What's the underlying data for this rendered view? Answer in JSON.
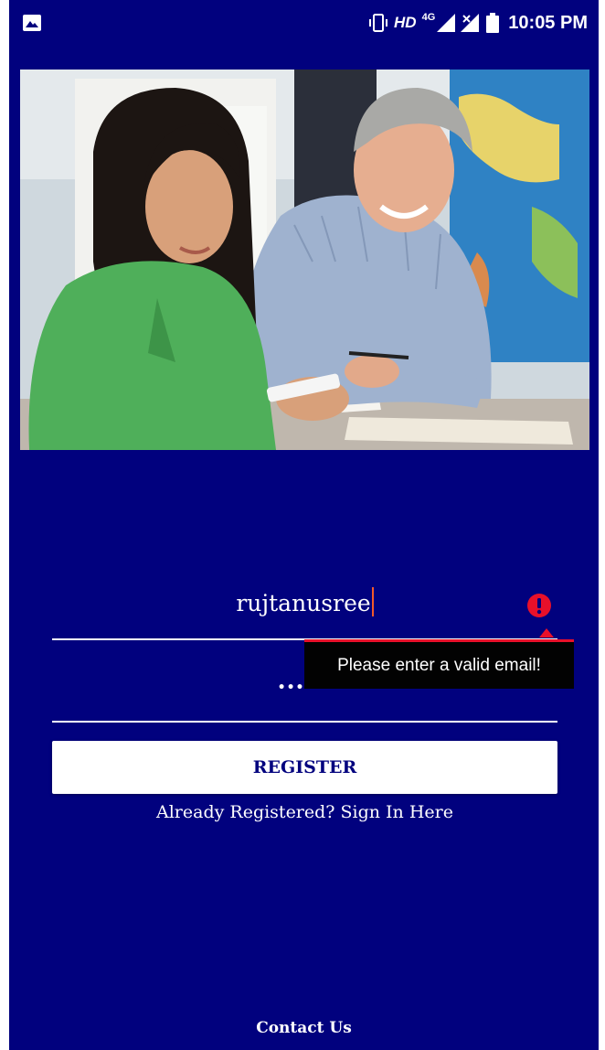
{
  "status_bar": {
    "network_label": "HD",
    "network_type": "4G",
    "time": "10:05 PM",
    "icons": [
      "image-icon",
      "vibrate-icon",
      "signal-icon",
      "no-signal-icon",
      "battery-icon"
    ]
  },
  "hero": {
    "image": "hero-photo"
  },
  "form": {
    "username_value": "rujtanusree",
    "password_value": "••••••",
    "error_message": "Please enter a valid email!",
    "register_label": "REGISTER",
    "signin_label": "Already Registered? Sign In Here"
  },
  "footer": {
    "contact_label": "Contact Us"
  },
  "colors": {
    "background": "#01017e",
    "error": "#e8102a",
    "caret": "#f35a2a"
  }
}
